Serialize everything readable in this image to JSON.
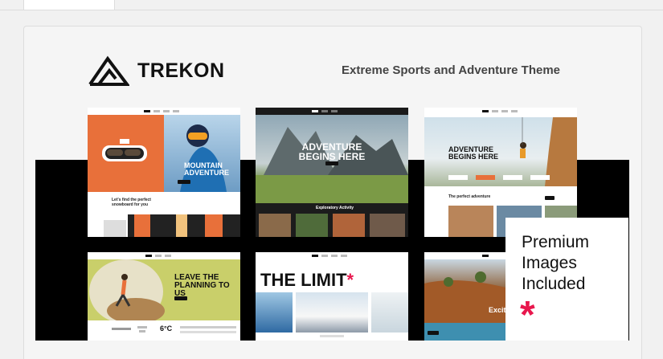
{
  "brand": {
    "name": "TREKON",
    "logo_icon": "mountain-logo-icon"
  },
  "tagline": "Extreme Sports and Adventure Theme",
  "screens": {
    "s1": {
      "title": "MOUNTAIN ADVENTURE",
      "subtitle": "Let's find the perfect snowboard for you"
    },
    "s2": {
      "title": "ADVENTURE BEGINS HERE",
      "section": "Exploratory Activity"
    },
    "s3": {
      "title": "ADVENTURE BEGINS HERE",
      "section": "The perfect adventure"
    },
    "s4": {
      "title": "LEAVE THE PLANNING TO US",
      "temp": "6°C"
    },
    "s5": {
      "title": "THE LIMIT",
      "star": "*"
    },
    "s6": {
      "title": "Exciting"
    }
  },
  "premium": {
    "text": "Premium Images Included",
    "star": "*"
  },
  "colors": {
    "accent": "#e8174d",
    "orange": "#e8703a",
    "olive": "#c9cf6a"
  }
}
